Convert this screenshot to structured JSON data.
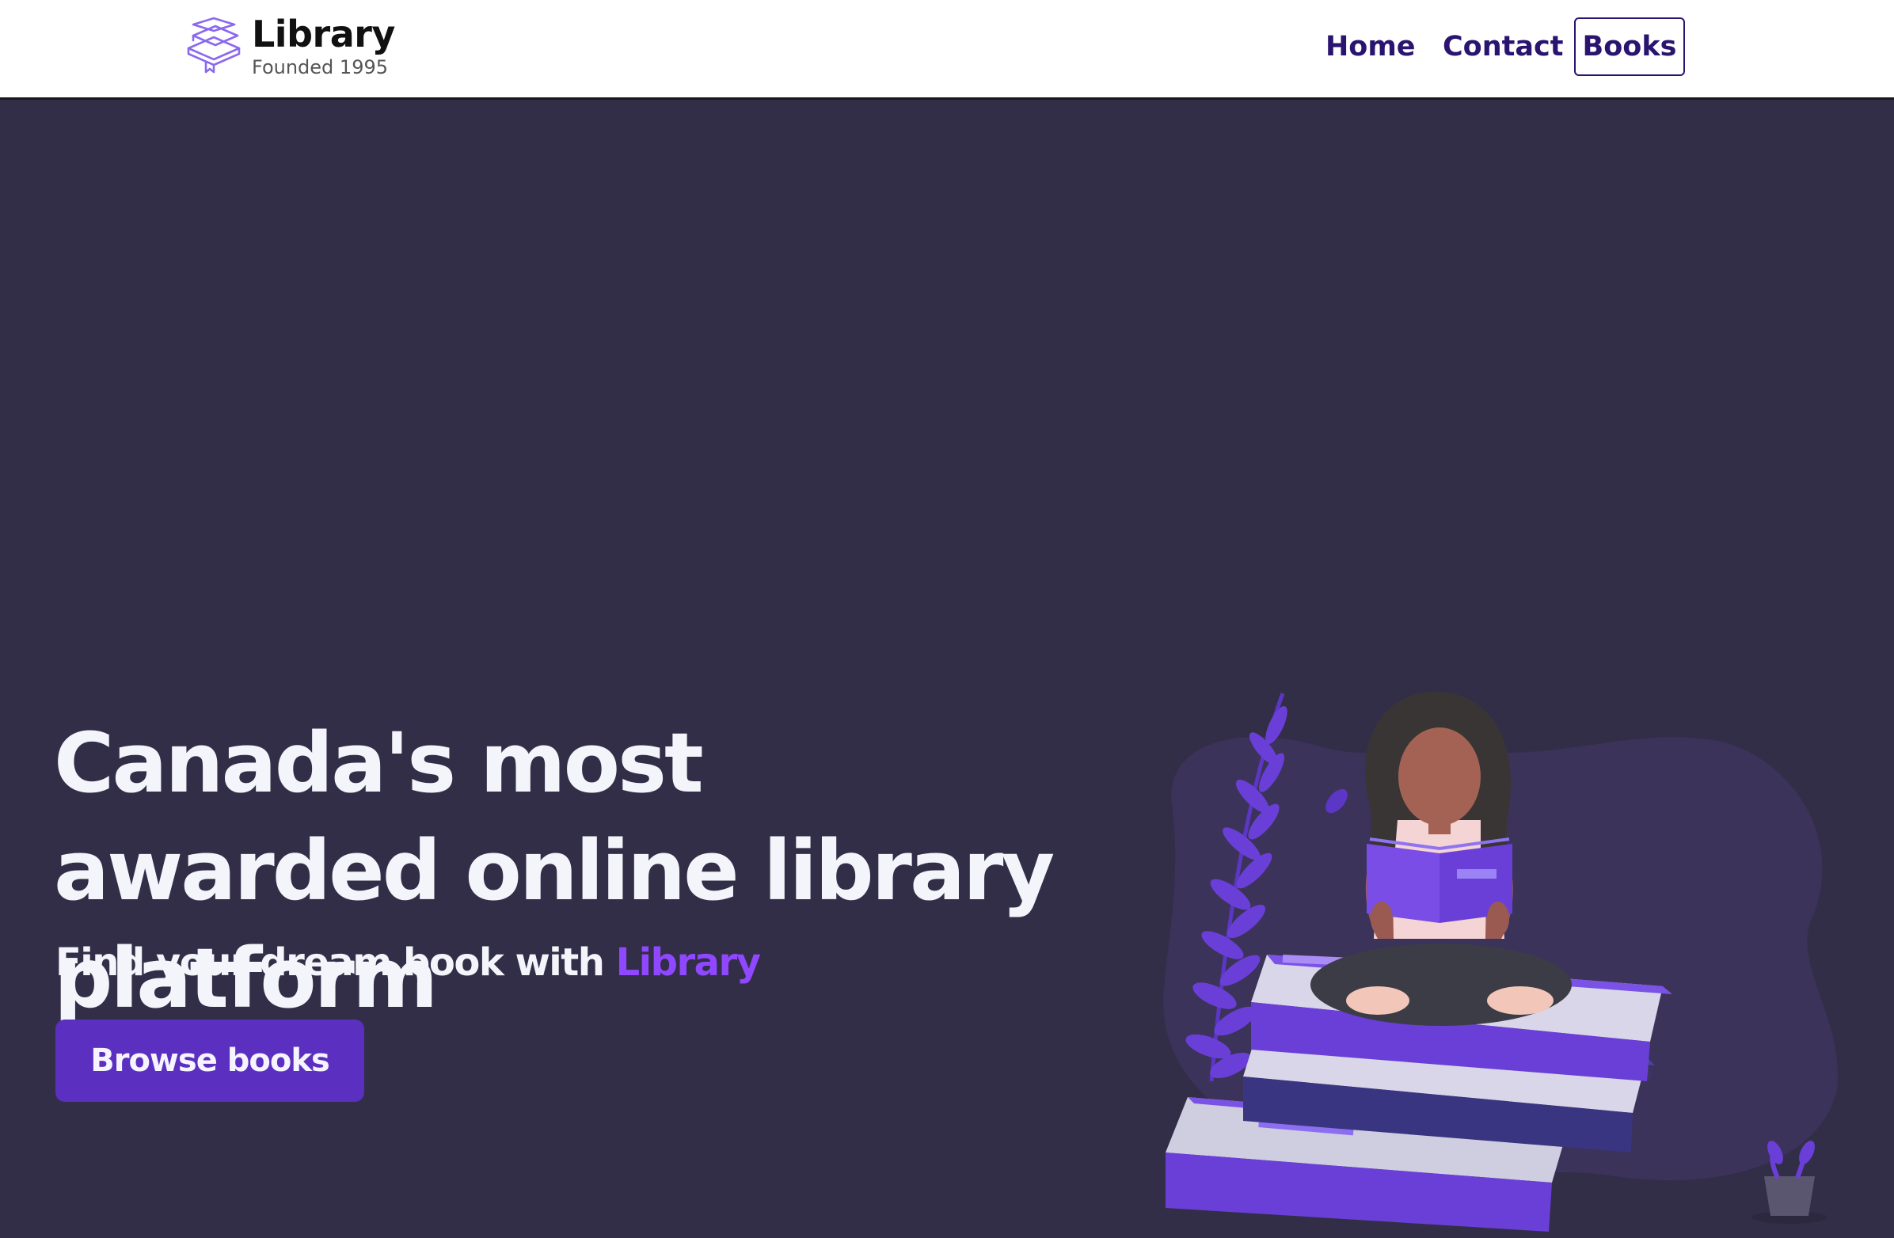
{
  "navbar": {
    "brand_title": "Library",
    "brand_subtitle": "Founded 1995",
    "logo_icon": "stacked-books-icon",
    "links": [
      {
        "label": "Home"
      },
      {
        "label": "Contact"
      },
      {
        "label": "Books",
        "active": true
      }
    ]
  },
  "hero": {
    "heading": "Canada's most awarded online library platform",
    "subheading_prefix": "Find your dream book with ",
    "subheading_accent": "Library",
    "cta_label": "Browse books",
    "illustration": "woman-reading-on-book-stack-illustration"
  },
  "colors": {
    "hero_background": "#332e48",
    "accent": "#8f47ff",
    "cta_background": "#5b2fc0",
    "nav_text": "#2a1470",
    "heading_text": "#f3f5fb"
  }
}
